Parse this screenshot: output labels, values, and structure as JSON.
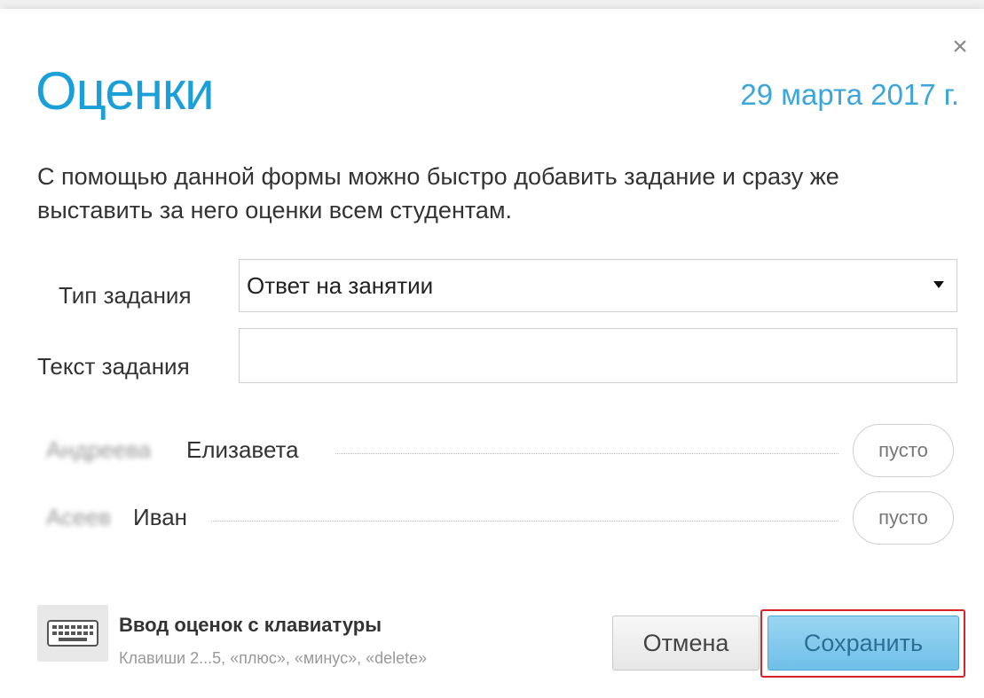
{
  "dialog": {
    "title": "Оценки",
    "date": "29 марта 2017 г.",
    "close_glyph": "×",
    "description": "С помощью данной формы можно быстро добавить задание и сразу же выставить за него оценки всем студентам."
  },
  "form": {
    "task_type_label": "Тип задания",
    "task_type_value": "Ответ на занятии",
    "task_text_label": "Текст задания",
    "task_text_value": ""
  },
  "students": [
    {
      "surname": "Андреева",
      "first_name": "Елизавета",
      "grade": "пусто"
    },
    {
      "surname": "Асеев",
      "first_name": "Иван",
      "grade": "пусто"
    }
  ],
  "keyboard": {
    "icon": "keyboard-icon",
    "title": "Ввод оценок с клавиатуры",
    "hint": "Клавиши 2...5, «плюс», «минус», «delete»"
  },
  "buttons": {
    "cancel_label": "Отмена",
    "save_label": "Сохранить"
  },
  "colors": {
    "accent": "#1a9fd8",
    "save_button": "#7fc7ec",
    "highlight": "#d8232a"
  }
}
